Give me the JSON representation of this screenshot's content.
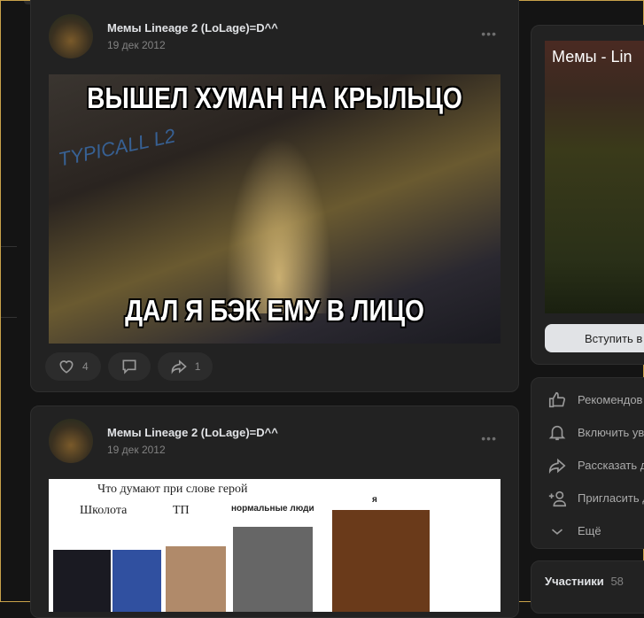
{
  "posts": [
    {
      "group": "Мемы Lineage 2 (LoLage)=D^^",
      "date": "19 дек 2012",
      "meme_top": "ВЫШЕЛ ХУМАН НА КРЫЛЬЦО",
      "meme_bottom": "ДАЛ Я БЭК ЕМУ В ЛИЦО",
      "watermark": "TYPICALL L2",
      "likes": "4",
      "shares": "1"
    },
    {
      "group": "Мемы Lineage 2 (LoLage)=D^^",
      "date": "19 дек 2012",
      "img_title": "Что думают при слове герой",
      "img_labels": [
        "Школота",
        "ТП",
        "нормальные люди",
        "я"
      ]
    }
  ],
  "sidebar": {
    "cover_title": "Мемы - Lin",
    "join": "Вступить в",
    "menu": [
      "Рекомендов",
      "Включить ув",
      "Рассказать д",
      "Пригласить д",
      "Ещё"
    ],
    "members_label": "Участники",
    "members_count": "58"
  }
}
